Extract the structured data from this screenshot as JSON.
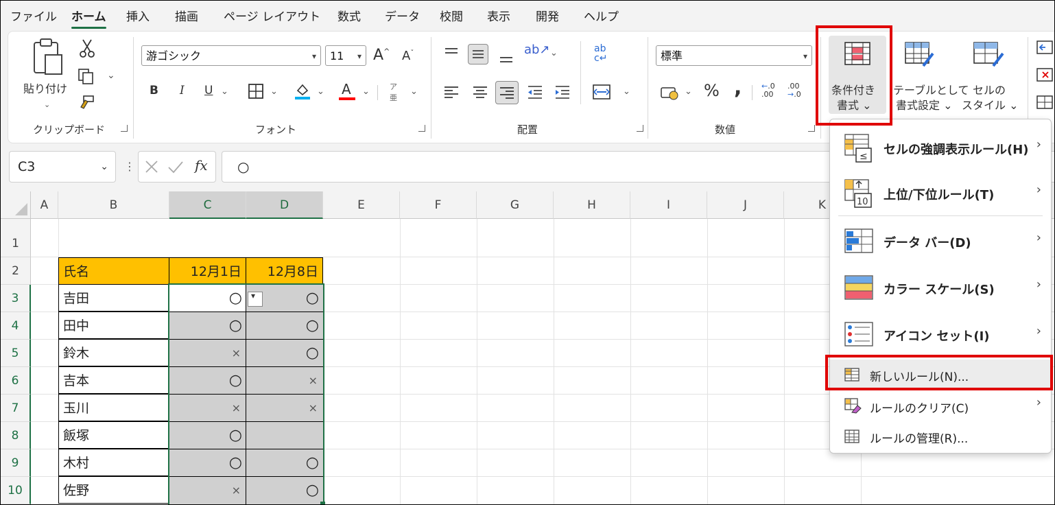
{
  "menu": [
    "ファイル",
    "ホーム",
    "挿入",
    "描画",
    "ページ レイアウト",
    "数式",
    "データ",
    "校閲",
    "表示",
    "開発",
    "ヘルプ"
  ],
  "ribbon": {
    "clipboard": {
      "paste": "貼り付け",
      "label": "クリップボード"
    },
    "font": {
      "name": "游ゴシック",
      "size": "11",
      "grow": "A",
      "shrink": "A",
      "bold": "B",
      "italic": "I",
      "underline": "U",
      "color_a": "A",
      "label": "フォント",
      "phonetic": "ア"
    },
    "alignment": {
      "label": "配置",
      "wrap_top": "ab"
    },
    "number": {
      "format": "標準",
      "percent": "%",
      "comma": ",",
      "label": "数値"
    },
    "styles": {
      "cond_line1": "条件付き",
      "cond_line2": "書式",
      "table_line1": "テーブルとして",
      "table_line2": "書式設定",
      "cell_line1": "セルの",
      "cell_line2": "スタイル"
    }
  },
  "formula_bar": {
    "name_box": "C3",
    "fx": "fx",
    "content": "○"
  },
  "columns": [
    "A",
    "B",
    "C",
    "D",
    "E",
    "F",
    "G",
    "H",
    "I",
    "J",
    "K"
  ],
  "rows": [
    "1",
    "2",
    "3",
    "4",
    "5",
    "6",
    "7",
    "8",
    "9",
    "10"
  ],
  "table": {
    "headers": [
      "氏名",
      "12月1日",
      "12月8日"
    ],
    "rows": [
      [
        "吉田",
        "○",
        "○"
      ],
      [
        "田中",
        "○",
        "○"
      ],
      [
        "鈴木",
        "×",
        "○"
      ],
      [
        "吉本",
        "○",
        "×"
      ],
      [
        "玉川",
        "×",
        "×"
      ],
      [
        "飯塚",
        "○",
        ""
      ],
      [
        "木村",
        "○",
        "○"
      ],
      [
        "佐野",
        "×",
        "○"
      ]
    ]
  },
  "dropdown": {
    "items": [
      {
        "label": "セルの強調表示ルール(H)",
        "arrow": "›"
      },
      {
        "label": "上位/下位ルール(T)",
        "arrow": "›"
      },
      {
        "label": "データ バー(D)",
        "arrow": "›"
      },
      {
        "label": "カラー スケール(S)",
        "arrow": "›"
      },
      {
        "label": "アイコン セット(I)",
        "arrow": "›"
      }
    ],
    "actions": [
      {
        "label": "新しいルール(N)...",
        "arrow": ""
      },
      {
        "label": "ルールのクリア(C)",
        "arrow": "›"
      },
      {
        "label": "ルールの管理(R)...",
        "arrow": ""
      }
    ]
  },
  "colors": {
    "accent": "#1e7145",
    "header_fill": "#ffc000",
    "selection_fill": "#d0d0d0",
    "highlight": "#e00000"
  }
}
